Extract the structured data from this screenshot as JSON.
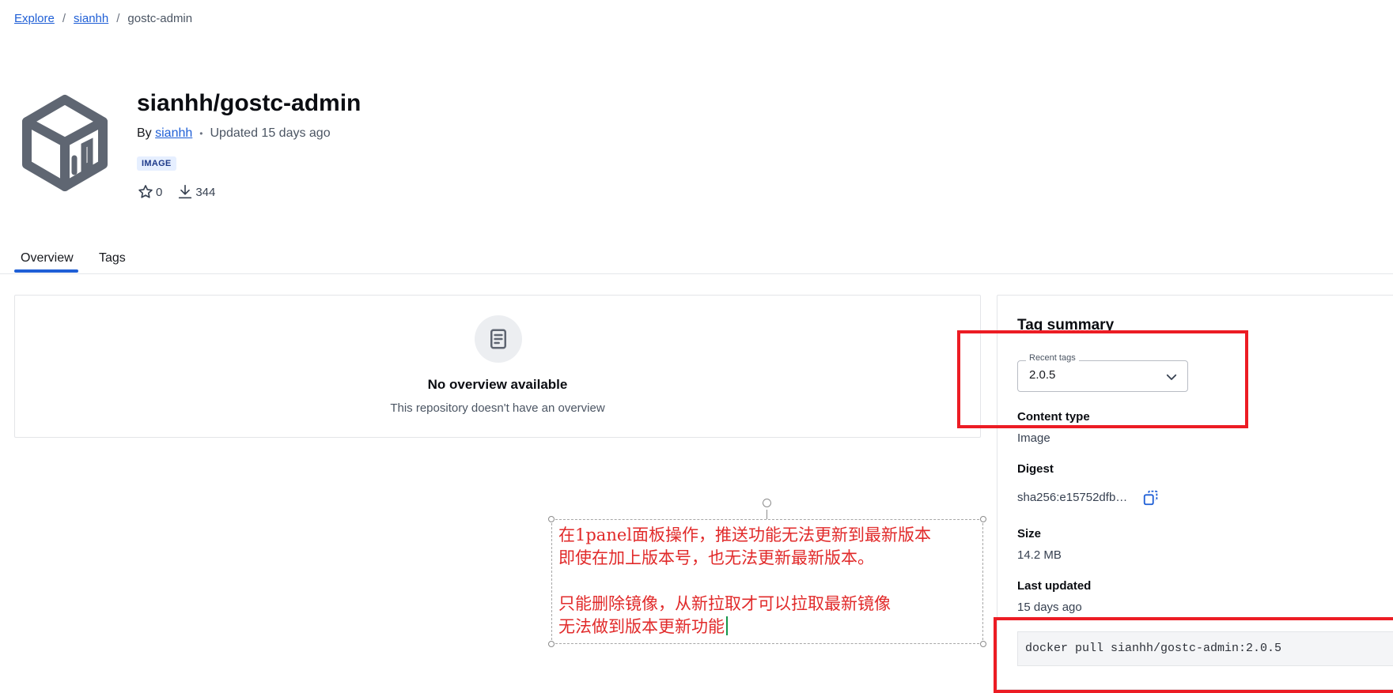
{
  "breadcrumb": {
    "items": [
      "Explore",
      "sianhh",
      "gostc-admin"
    ],
    "separator": "/"
  },
  "header": {
    "title": "sianhh/gostc-admin",
    "by_label": "By",
    "author": "sianhh",
    "updated": "Updated 15 days ago",
    "badge": "IMAGE",
    "stars": "0",
    "downloads": "344"
  },
  "tabs": [
    {
      "label": "Overview",
      "active": true
    },
    {
      "label": "Tags",
      "active": false
    }
  ],
  "overview": {
    "title": "No overview available",
    "subtitle": "This repository doesn't have an overview"
  },
  "tag_summary": {
    "title": "Tag summary",
    "recent_tags_label": "Recent tags",
    "selected_tag": "2.0.5",
    "content_type_label": "Content type",
    "content_type_value": "Image",
    "digest_label": "Digest",
    "digest_value": "sha256:e15752dfb…",
    "size_label": "Size",
    "size_value": "14.2 MB",
    "last_updated_label": "Last updated",
    "last_updated_value": "15 days ago",
    "pull_command": "docker pull sianhh/gostc-admin:2.0.5"
  },
  "annotation": {
    "note_line1": "在1panel面板操作，推送功能无法更新到最新版本",
    "note_line2": "即使在加上版本号，也无法更新最新版本。",
    "note_line3": "",
    "note_line4": "只能删除镜像，从新拉取才可以拉取最新镜像",
    "note_line5": "无法做到版本更新功能"
  },
  "colors": {
    "accent": "#1f5fd6",
    "annotation_red": "#ec1c24",
    "note_text": "#e12a2a"
  },
  "icons": [
    "repository-cube-icon",
    "star-icon",
    "download-icon",
    "document-icon",
    "chevron-down-icon",
    "copy-icon"
  ]
}
